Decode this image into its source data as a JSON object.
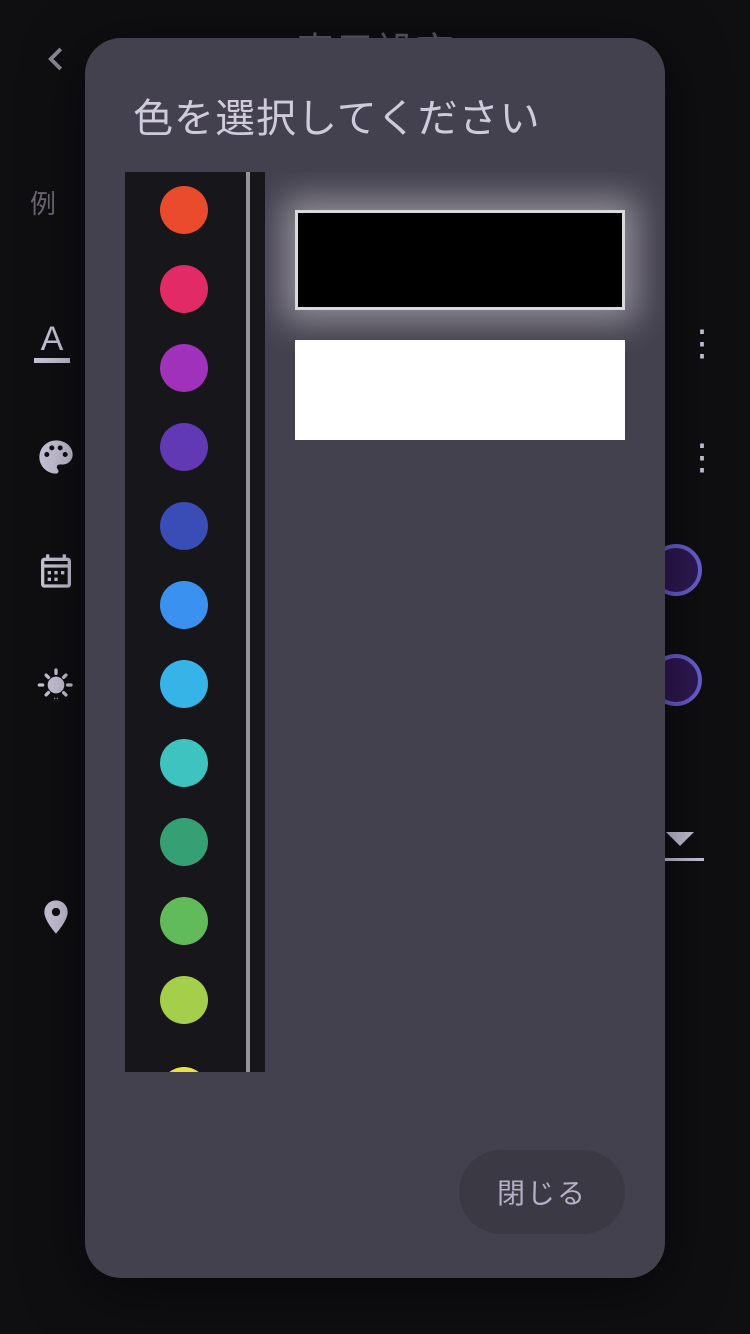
{
  "background": {
    "title": "表示設定",
    "example_label": "例",
    "font_glyph": "A",
    "right_controls": {
      "circle_fill": "#2f1954",
      "circle_border": "#6a5fd0"
    }
  },
  "modal": {
    "title": "色を選択してください",
    "close_label": "閉じる",
    "preview": {
      "selected_color": "#000000",
      "secondary_color": "#ffffff"
    },
    "swatches": [
      "#e94b2c",
      "#e12a66",
      "#a031ba",
      "#6239b5",
      "#3a4cb6",
      "#3b91f0",
      "#36b4e8",
      "#3fc3c1",
      "#35a074",
      "#62bb5a",
      "#a5cf4b",
      "#e8e23a"
    ]
  }
}
